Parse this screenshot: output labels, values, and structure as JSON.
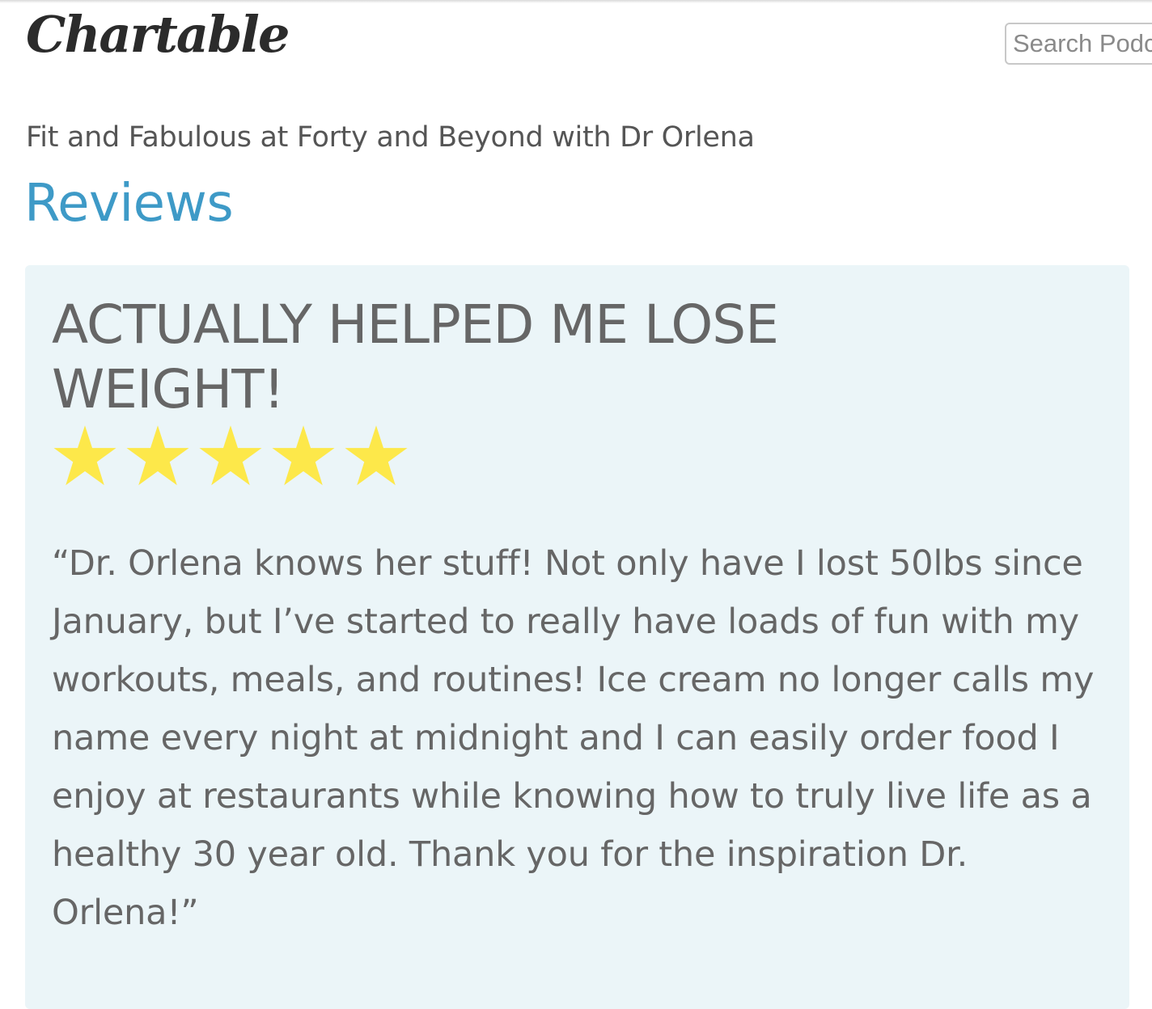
{
  "header": {
    "logo_text": "Chartable",
    "search_placeholder": "Search Podcasts"
  },
  "podcast": {
    "title": "Fit and Fabulous at Forty and Beyond with Dr Orlena"
  },
  "section": {
    "title": "Reviews"
  },
  "review": {
    "title": "ACTUALLY HELPED ME LOSE WEIGHT!",
    "rating": 5,
    "rating_max": 5,
    "star_color": "#fde84a",
    "body": "“Dr. Orlena knows her stuff! Not only have I lost 50lbs since January, but I’ve started to really have loads of fun with my workouts, meals, and routines! Ice cream no longer calls my name every night at midnight and I can easily order food I enjoy at restaurants while knowing how to truly live life as a healthy 30 year old. Thank you for the inspiration Dr. Orlena!”"
  },
  "colors": {
    "accent": "#3e9ac7",
    "card_background": "#ebf5f8",
    "text": "#666666"
  }
}
